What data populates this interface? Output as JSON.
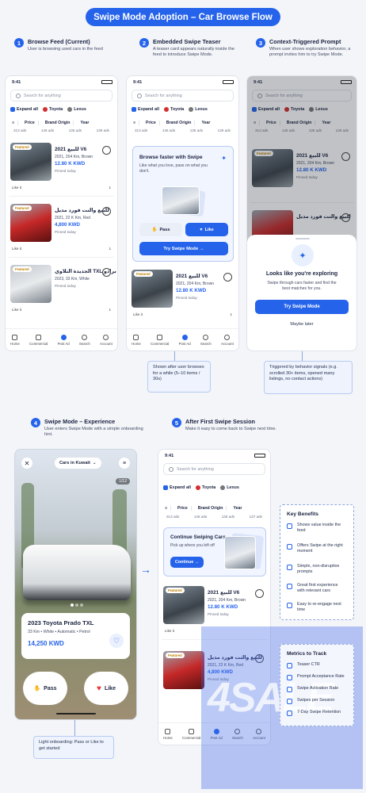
{
  "title": "Swipe Mode Adoption – Car Browse Flow",
  "steps": [
    {
      "num": "1",
      "title": "Browse Feed (Current)",
      "desc": "User is browsing used cars in the feed"
    },
    {
      "num": "2",
      "title": "Embedded Swipe Teaser",
      "desc": "A teaser card appears naturally inside the feed to introduce Swipe Mode."
    },
    {
      "num": "3",
      "title": "Context-Triggered Prompt",
      "desc": "When user shows exploration behavior, a prompt invites him to try Swipe Mode."
    },
    {
      "num": "4",
      "title": "Swipe Mode – Experience",
      "desc": "User enters Swipe Mode with a simple onboarding hint."
    },
    {
      "num": "5",
      "title": "After First Swipe Session",
      "desc": "Make it easy to come back to Swipe next time."
    }
  ],
  "app": {
    "time": "9:41",
    "search_placeholder": "Search for anything",
    "tabs": [
      "Expand all",
      "Toyota",
      "Lexus"
    ],
    "filters": [
      "Price",
      "Brand Origin",
      "Year"
    ],
    "counts": [
      "313 ads",
      "146 ads",
      "135 ads",
      "139 ads",
      "137 ads"
    ],
    "nav": [
      "Home",
      "Commercial",
      "Post Ad",
      "Search",
      "Account"
    ],
    "featured": "Featured",
    "like": "Like it",
    "like_count": "1",
    "pinned": "Pinned today"
  },
  "listings": [
    {
      "title": "2021 للبيع V6",
      "details": "2021, 204 Km, Brown",
      "price": "12.80 K KWD"
    },
    {
      "title": "للبيع والنت فورد مديل",
      "details": "2021, 22 K Km, Red",
      "price": "4,800 KWD"
    },
    {
      "title": "الجديدة التلاوي TXL برادو",
      "details": "2023, 33 Km, White",
      "price": ""
    }
  ],
  "teaser": {
    "title": "Browse faster with Swipe",
    "desc": "Like what you love, pass on what you don't.",
    "pass": "Pass",
    "like": "Like",
    "cta": "Try Swipe Mode →"
  },
  "prompt": {
    "title": "Looks like you're exploring",
    "desc": "Swipe through cars faster and find the best matches for you.",
    "cta": "Try Swipe Mode",
    "later": "Maybe later"
  },
  "notes": {
    "teaser": "Shown after user browses for a while (5–10 items / 30s)",
    "prompt": "Triggered by behavior signals (e.g. scrolled 30+ items, opened many listings, no contact actions)",
    "onboarding": "Light onboarding: Pass or Like to get started"
  },
  "swipe": {
    "location": "Cars in Kuwait",
    "counter": "1/12",
    "car": "2023 Toyota Prado TXL",
    "meta": "33 Km • White • Automatic • Petrol",
    "price": "14,250 KWD",
    "pass": "Pass",
    "like": "Like"
  },
  "continue_card": {
    "title": "Continue Swiping Cars",
    "desc": "Pick up where you left off",
    "cta": "Continue →"
  },
  "benefits": {
    "title": "Key Benefits",
    "items": [
      "Shows value inside the feed",
      "Offers Swipe at the right moment",
      "Simple, non-disruptive prompts",
      "Great first experience with relevant cars",
      "Easy to re-engage next time"
    ]
  },
  "metrics": {
    "title": "Metrics to Track",
    "items": [
      "Teaser CTR",
      "Prompt Acceptance Rate",
      "Swipe Activation Rate",
      "Swipes per Session",
      "7-Day Swipe Retention"
    ]
  },
  "watermark": "4SALE",
  "colors": {
    "accent": "#2563eb",
    "price": "#2563eb",
    "featured": "#c08000",
    "like_heart": "#e53935"
  }
}
